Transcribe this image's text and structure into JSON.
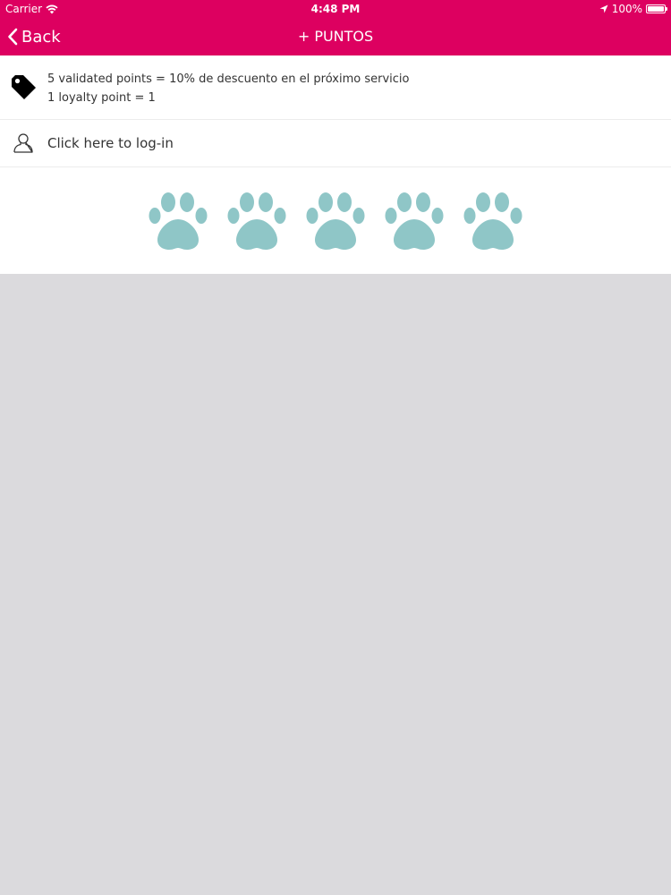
{
  "status_bar": {
    "carrier": "Carrier",
    "time": "4:48 PM",
    "battery": "100%",
    "battery_level": 1.0
  },
  "nav": {
    "back_label": "Back",
    "title": "+ PUNTOS"
  },
  "info": {
    "line1": "5 validated points = 10% de descuento en el próximo servicio",
    "line2": "1 loyalty point = 1",
    "icon": "tag-icon"
  },
  "login": {
    "label": "Click here to log-in",
    "icon": "user-icon"
  },
  "paws": {
    "count": 5,
    "icon": "paw-icon"
  },
  "colors": {
    "header": "#dd0060",
    "paw": "#8fc6c7",
    "background": "#dbdadd"
  }
}
